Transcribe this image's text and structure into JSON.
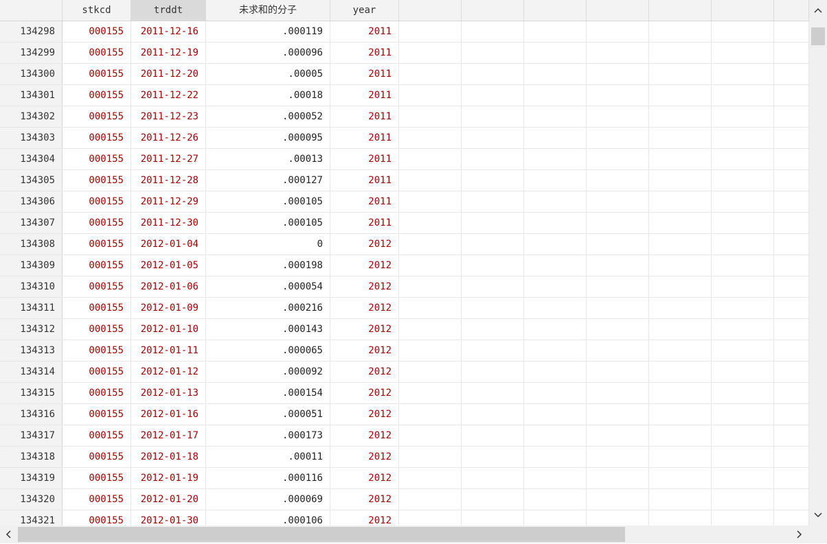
{
  "columns": [
    "",
    "stkcd",
    "trddt",
    "未求和的分子",
    "year"
  ],
  "rows": [
    {
      "obs": "134298",
      "stkcd": "000155",
      "trddt": "2011-12-16",
      "val": ".000119",
      "year": "2011"
    },
    {
      "obs": "134299",
      "stkcd": "000155",
      "trddt": "2011-12-19",
      "val": ".000096",
      "year": "2011"
    },
    {
      "obs": "134300",
      "stkcd": "000155",
      "trddt": "2011-12-20",
      "val": ".00005",
      "year": "2011"
    },
    {
      "obs": "134301",
      "stkcd": "000155",
      "trddt": "2011-12-22",
      "val": ".00018",
      "year": "2011"
    },
    {
      "obs": "134302",
      "stkcd": "000155",
      "trddt": "2011-12-23",
      "val": ".000052",
      "year": "2011"
    },
    {
      "obs": "134303",
      "stkcd": "000155",
      "trddt": "2011-12-26",
      "val": ".000095",
      "year": "2011"
    },
    {
      "obs": "134304",
      "stkcd": "000155",
      "trddt": "2011-12-27",
      "val": ".00013",
      "year": "2011"
    },
    {
      "obs": "134305",
      "stkcd": "000155",
      "trddt": "2011-12-28",
      "val": ".000127",
      "year": "2011"
    },
    {
      "obs": "134306",
      "stkcd": "000155",
      "trddt": "2011-12-29",
      "val": ".000105",
      "year": "2011"
    },
    {
      "obs": "134307",
      "stkcd": "000155",
      "trddt": "2011-12-30",
      "val": ".000105",
      "year": "2011"
    },
    {
      "obs": "134308",
      "stkcd": "000155",
      "trddt": "2012-01-04",
      "val": "0",
      "year": "2012"
    },
    {
      "obs": "134309",
      "stkcd": "000155",
      "trddt": "2012-01-05",
      "val": ".000198",
      "year": "2012"
    },
    {
      "obs": "134310",
      "stkcd": "000155",
      "trddt": "2012-01-06",
      "val": ".000054",
      "year": "2012"
    },
    {
      "obs": "134311",
      "stkcd": "000155",
      "trddt": "2012-01-09",
      "val": ".000216",
      "year": "2012"
    },
    {
      "obs": "134312",
      "stkcd": "000155",
      "trddt": "2012-01-10",
      "val": ".000143",
      "year": "2012"
    },
    {
      "obs": "134313",
      "stkcd": "000155",
      "trddt": "2012-01-11",
      "val": ".000065",
      "year": "2012"
    },
    {
      "obs": "134314",
      "stkcd": "000155",
      "trddt": "2012-01-12",
      "val": ".000092",
      "year": "2012"
    },
    {
      "obs": "134315",
      "stkcd": "000155",
      "trddt": "2012-01-13",
      "val": ".000154",
      "year": "2012"
    },
    {
      "obs": "134316",
      "stkcd": "000155",
      "trddt": "2012-01-16",
      "val": ".000051",
      "year": "2012"
    },
    {
      "obs": "134317",
      "stkcd": "000155",
      "trddt": "2012-01-17",
      "val": ".000173",
      "year": "2012"
    },
    {
      "obs": "134318",
      "stkcd": "000155",
      "trddt": "2012-01-18",
      "val": ".00011",
      "year": "2012"
    },
    {
      "obs": "134319",
      "stkcd": "000155",
      "trddt": "2012-01-19",
      "val": ".000116",
      "year": "2012"
    },
    {
      "obs": "134320",
      "stkcd": "000155",
      "trddt": "2012-01-20",
      "val": ".000069",
      "year": "2012"
    },
    {
      "obs": "134321",
      "stkcd": "000155",
      "trddt": "2012-01-30",
      "val": ".000106",
      "year": "2012"
    }
  ],
  "scroll": {
    "up_icon": "chevron-up-icon",
    "down_icon": "chevron-down-icon",
    "left_icon": "chevron-left-icon",
    "right_icon": "chevron-right-icon"
  },
  "colors": {
    "string_var": "#a40000",
    "numeric_var": "#222222",
    "header_bg": "#f3f3f3",
    "selected_header_bg": "#dadada"
  }
}
